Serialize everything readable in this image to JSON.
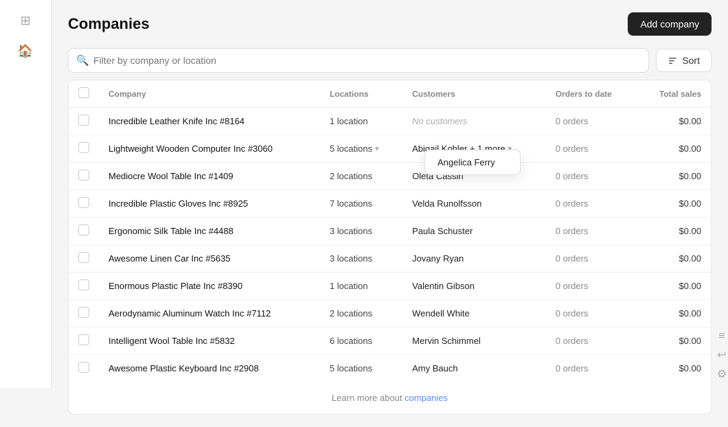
{
  "page": {
    "title": "Companies",
    "add_button_label": "Add company"
  },
  "toolbar": {
    "search_placeholder": "Filter by company or location",
    "sort_label": "Sort"
  },
  "table": {
    "headers": [
      "",
      "Company",
      "Locations",
      "Customers",
      "Orders to date",
      "Total sales"
    ],
    "rows": [
      {
        "company": "Incredible Leather Knife Inc #8164",
        "locations": "1 location",
        "locations_dropdown": false,
        "customers": "No customers",
        "customers_italic": true,
        "orders": "0 orders",
        "sales": "$0.00"
      },
      {
        "company": "Lightweight Wooden Computer Inc #3060",
        "locations": "5 locations",
        "locations_dropdown": true,
        "customers": "Abigail Kohler + 1 more",
        "customers_italic": false,
        "customers_plus": true,
        "orders": "0 orders",
        "sales": "$0.00"
      },
      {
        "company": "Mediocre Wool Table Inc #1409",
        "locations": "2 locations",
        "locations_dropdown": false,
        "customers": "Oleta Cassin",
        "customers_italic": false,
        "orders": "0 orders",
        "sales": "$0.00"
      },
      {
        "company": "Incredible Plastic Gloves Inc #8925",
        "locations": "7 locations",
        "locations_dropdown": false,
        "customers": "Velda Runolfsson",
        "customers_italic": false,
        "orders": "0 orders",
        "sales": "$0.00"
      },
      {
        "company": "Ergonomic Silk Table Inc #4488",
        "locations": "3 locations",
        "locations_dropdown": false,
        "customers": "Paula Schuster",
        "customers_italic": false,
        "orders": "0 orders",
        "sales": "$0.00"
      },
      {
        "company": "Awesome Linen Car Inc #5635",
        "locations": "3 locations",
        "locations_dropdown": false,
        "customers": "Jovany Ryan",
        "customers_italic": false,
        "orders": "0 orders",
        "sales": "$0.00"
      },
      {
        "company": "Enormous Plastic Plate Inc #8390",
        "locations": "1 location",
        "locations_dropdown": false,
        "customers": "Valentin Gibson",
        "customers_italic": false,
        "orders": "0 orders",
        "sales": "$0.00"
      },
      {
        "company": "Aerodynamic Aluminum Watch Inc #7112",
        "locations": "2 locations",
        "locations_dropdown": false,
        "customers": "Wendell White",
        "customers_italic": false,
        "orders": "0 orders",
        "sales": "$0.00"
      },
      {
        "company": "Intelligent Wool Table Inc #5832",
        "locations": "6 locations",
        "locations_dropdown": false,
        "customers": "Mervin Schimmel",
        "customers_italic": false,
        "orders": "0 orders",
        "sales": "$0.00"
      },
      {
        "company": "Awesome Plastic Keyboard Inc #2908",
        "locations": "5 locations",
        "locations_dropdown": false,
        "customers": "Amy Bauch",
        "customers_italic": false,
        "orders": "0 orders",
        "sales": "$0.00"
      }
    ],
    "footer_text": "Learn more about",
    "footer_link": "companies"
  },
  "tooltip": {
    "name": "Angelica Ferry"
  }
}
